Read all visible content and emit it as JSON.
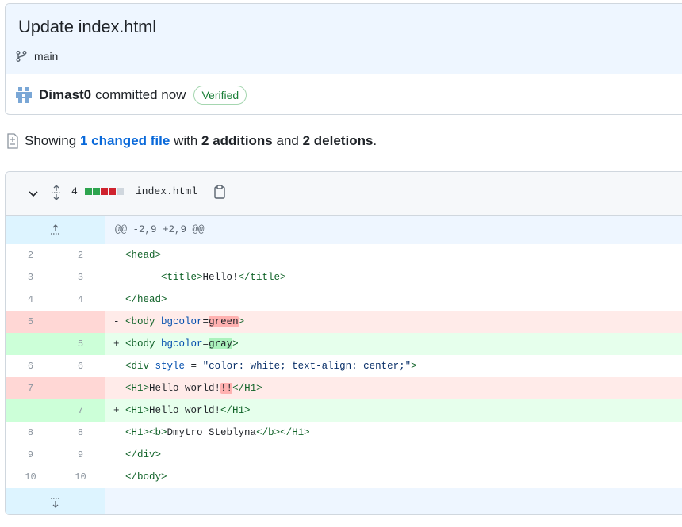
{
  "commit": {
    "title": "Update index.html",
    "branch": "main",
    "author": "Dimast0",
    "committed_text": "committed now",
    "verified_label": "Verified"
  },
  "summary": {
    "showing": "Showing",
    "changed_files": "1 changed file",
    "with": "with",
    "additions": "2 additions",
    "and": "and",
    "deletions": "2 deletions",
    "period": "."
  },
  "diff": {
    "change_count": "4",
    "diffstat": [
      "add",
      "add",
      "del",
      "del",
      "neutral"
    ],
    "filename": "index.html",
    "hunk_header": "@@ -2,9 +2,9 @@",
    "lines": [
      {
        "type": "ctx",
        "old": "2",
        "new": "2",
        "parts": [
          [
            "p",
            "  "
          ],
          [
            "t",
            "<head>"
          ]
        ]
      },
      {
        "type": "ctx",
        "old": "3",
        "new": "3",
        "parts": [
          [
            "p",
            "        "
          ],
          [
            "t",
            "<title>"
          ],
          [
            "p",
            "Hello!"
          ],
          [
            "t",
            "</title>"
          ]
        ]
      },
      {
        "type": "ctx",
        "old": "4",
        "new": "4",
        "parts": [
          [
            "p",
            "  "
          ],
          [
            "t",
            "</head>"
          ]
        ]
      },
      {
        "type": "del",
        "old": "5",
        "new": "",
        "parts": [
          [
            "p",
            "- "
          ],
          [
            "t",
            "<body "
          ],
          [
            "a",
            "bgcolor"
          ],
          [
            "p",
            "="
          ],
          [
            "hd",
            "green"
          ],
          [
            "t",
            ">"
          ]
        ]
      },
      {
        "type": "add",
        "old": "",
        "new": "5",
        "parts": [
          [
            "p",
            "+ "
          ],
          [
            "t",
            "<body "
          ],
          [
            "a",
            "bgcolor"
          ],
          [
            "p",
            "="
          ],
          [
            "ha",
            "gray"
          ],
          [
            "t",
            ">"
          ]
        ]
      },
      {
        "type": "ctx",
        "old": "6",
        "new": "6",
        "parts": [
          [
            "p",
            "  "
          ],
          [
            "t",
            "<div "
          ],
          [
            "a",
            "style"
          ],
          [
            "p",
            " = "
          ],
          [
            "s",
            "\"color: white; text-align: center;\""
          ],
          [
            "t",
            ">"
          ]
        ]
      },
      {
        "type": "del",
        "old": "7",
        "new": "",
        "parts": [
          [
            "p",
            "- "
          ],
          [
            "t",
            "<H1>"
          ],
          [
            "p",
            "Hello world!"
          ],
          [
            "hd",
            "!!"
          ],
          [
            "t",
            "</H1>"
          ]
        ]
      },
      {
        "type": "add",
        "old": "",
        "new": "7",
        "parts": [
          [
            "p",
            "+ "
          ],
          [
            "t",
            "<H1>"
          ],
          [
            "p",
            "Hello world!"
          ],
          [
            "t",
            "</H1>"
          ]
        ]
      },
      {
        "type": "ctx",
        "old": "8",
        "new": "8",
        "parts": [
          [
            "p",
            "  "
          ],
          [
            "t",
            "<H1><b>"
          ],
          [
            "p",
            "Dmytro Steblyna"
          ],
          [
            "t",
            "</b></H1>"
          ]
        ]
      },
      {
        "type": "ctx",
        "old": "9",
        "new": "9",
        "parts": [
          [
            "p",
            "  "
          ],
          [
            "t",
            "</div>"
          ]
        ]
      },
      {
        "type": "ctx",
        "old": "10",
        "new": "10",
        "parts": [
          [
            "p",
            "  "
          ],
          [
            "t",
            "</body>"
          ]
        ]
      }
    ]
  },
  "icons": {
    "branch": "git-branch-icon",
    "avatar": "user-avatar-icon",
    "file_diff": "file-diff-icon",
    "collapse": "chevron-down-icon",
    "expand_all": "unfold-icon",
    "copy": "copy-icon",
    "expand_up": "fold-up-icon",
    "expand_down": "fold-down-icon"
  },
  "colors": {
    "addition": "#2da44e",
    "deletion": "#cf222e",
    "verified": "#1a7f37",
    "link": "#0969da"
  }
}
